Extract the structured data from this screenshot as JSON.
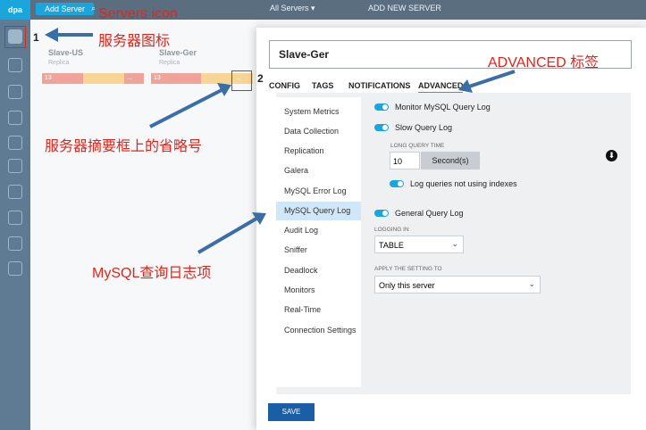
{
  "topbar": {
    "left_btn": "Add Server",
    "servers_select": "All Servers ▾",
    "add_new": "ADD NEW SERVER"
  },
  "logo": "dpa",
  "servers": [
    {
      "name": "Slave-US",
      "status": "Replica",
      "cells": [
        "13",
        "",
        "..."
      ]
    },
    {
      "name": "Slave-Ger",
      "status": "Replica",
      "cells": [
        "13",
        "",
        "..."
      ]
    }
  ],
  "modal": {
    "title": "Slave-Ger",
    "tabs": [
      "CONFIG",
      "TAGS",
      "NOTIFICATIONS",
      "ADVANCED"
    ],
    "menu": [
      "System Metrics",
      "Data Collection",
      "Replication",
      "Galera",
      "MySQL Error Log",
      "MySQL Query Log",
      "Audit Log",
      "Sniffer",
      "Deadlock",
      "Monitors",
      "Real-Time",
      "Connection Settings"
    ],
    "monitor_query_log": "Monitor MySQL Query Log",
    "slow_query_log": "Slow Query Log",
    "long_query_time_label": "LONG QUERY TIME",
    "long_query_time_value": "10",
    "long_query_time_unit": "Second(s)",
    "log_no_indexes": "Log queries not using indexes",
    "general_query_log": "General Query Log",
    "logging_in_label": "LOGGING IN",
    "logging_in_value": "TABLE",
    "apply_label": "APPLY THE SETTING TO",
    "apply_value": "Only this server",
    "save": "SAVE"
  },
  "annotations": {
    "servers_icon_en": "Servers icon",
    "servers_icon_zh": "服务器图标",
    "advanced_tab": "ADVANCED 标签",
    "ellipsis": "服务器摘要框上的省略号",
    "query_log_item": "MySQL查询日志项",
    "num1": "1",
    "num2": "2"
  },
  "colors": {
    "accent": "#1aa5dd",
    "annotation": "#e0251b",
    "arrow": "#3a6ea5",
    "save": "#1b5ea8"
  }
}
